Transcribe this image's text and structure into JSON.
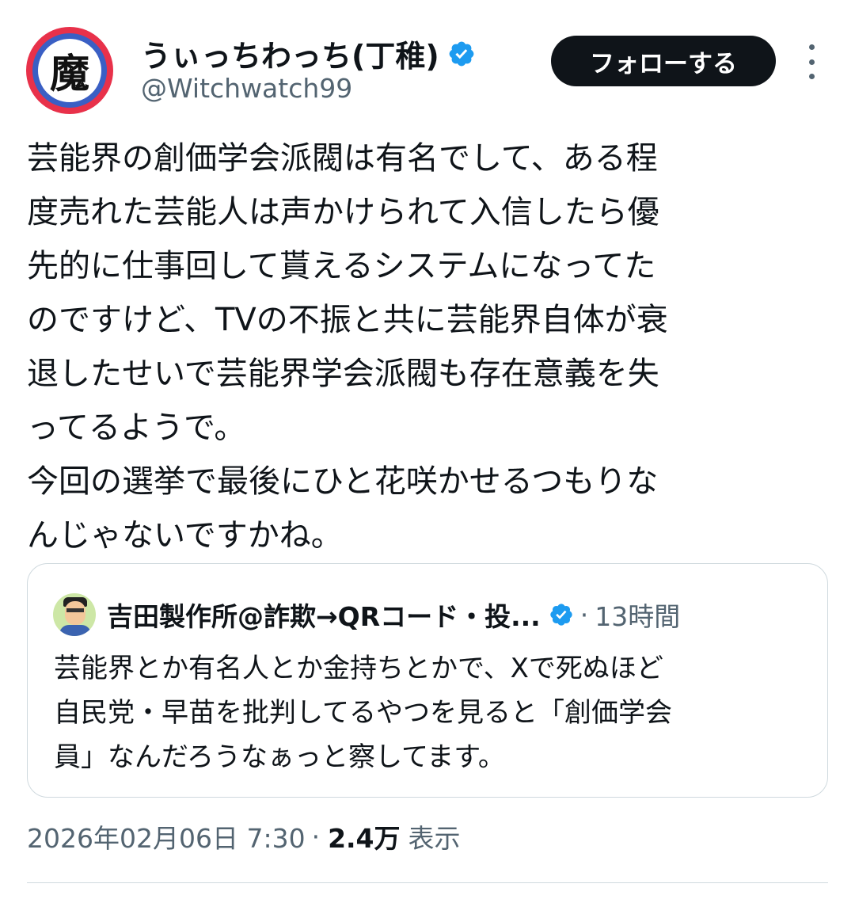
{
  "author": {
    "avatar_glyph": "魔",
    "display_name": "うぃっちわっち(丁稚)",
    "handle": "@Witchwatch99",
    "verified_icon": "verified-badge-icon",
    "verified_color": "#1d9bf0"
  },
  "actions": {
    "follow_label": "フォローする",
    "more_icon": "more-vertical-icon"
  },
  "tweet": {
    "lines": [
      "芸能界の創価学会派閥は有名でして、ある程",
      "度売れた芸能人は声かけられて入信したら優",
      "先的に仕事回して貰えるシステムになってた",
      "のですけど、TVの不振と共に芸能界自体が衰",
      "退したせいで芸能界学会派閥も存在意義を失",
      "ってるようで。",
      "今回の選挙で最後にひと花咲かせるつもりな",
      "んじゃないですかね。"
    ]
  },
  "quote": {
    "author_name": "吉田製作所@詐欺→QRコード・投...",
    "separator": "·",
    "time_ago": "13時間",
    "lines": [
      "芸能界とか有名人とか金持ちとかで、Xで死ぬほど",
      "自民党・早苗を批判してるやつを見ると「創価学会",
      "員」なんだろうなぁっと察してます。"
    ]
  },
  "meta": {
    "timestamp": "2026年02月06日 7:30",
    "separator": "·",
    "views_count": "2.4万",
    "views_label": "表示"
  },
  "colors": {
    "text_primary": "#0f1419",
    "text_secondary": "#536471",
    "border": "#cfd9de",
    "button_bg": "#0f1419"
  }
}
